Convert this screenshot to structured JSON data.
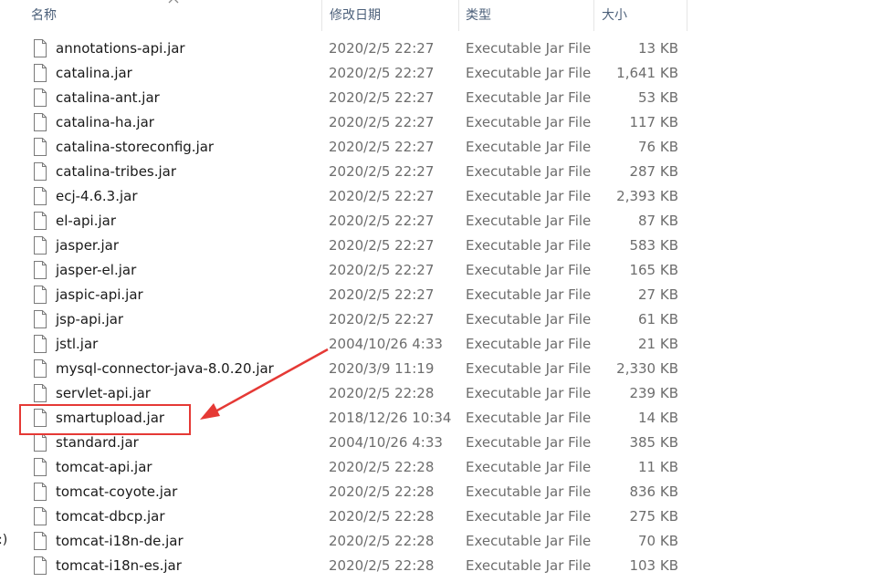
{
  "columns": {
    "name": "名称",
    "date": "修改日期",
    "type": "类型",
    "size": "大小"
  },
  "edge_text": ":)",
  "files": [
    {
      "name": "annotations-api.jar",
      "date": "2020/2/5 22:27",
      "type": "Executable Jar File",
      "size": "13 KB"
    },
    {
      "name": "catalina.jar",
      "date": "2020/2/5 22:27",
      "type": "Executable Jar File",
      "size": "1,641 KB"
    },
    {
      "name": "catalina-ant.jar",
      "date": "2020/2/5 22:27",
      "type": "Executable Jar File",
      "size": "53 KB"
    },
    {
      "name": "catalina-ha.jar",
      "date": "2020/2/5 22:27",
      "type": "Executable Jar File",
      "size": "117 KB"
    },
    {
      "name": "catalina-storeconfig.jar",
      "date": "2020/2/5 22:27",
      "type": "Executable Jar File",
      "size": "76 KB"
    },
    {
      "name": "catalina-tribes.jar",
      "date": "2020/2/5 22:27",
      "type": "Executable Jar File",
      "size": "287 KB"
    },
    {
      "name": "ecj-4.6.3.jar",
      "date": "2020/2/5 22:27",
      "type": "Executable Jar File",
      "size": "2,393 KB"
    },
    {
      "name": "el-api.jar",
      "date": "2020/2/5 22:27",
      "type": "Executable Jar File",
      "size": "87 KB"
    },
    {
      "name": "jasper.jar",
      "date": "2020/2/5 22:27",
      "type": "Executable Jar File",
      "size": "583 KB"
    },
    {
      "name": "jasper-el.jar",
      "date": "2020/2/5 22:27",
      "type": "Executable Jar File",
      "size": "165 KB"
    },
    {
      "name": "jaspic-api.jar",
      "date": "2020/2/5 22:27",
      "type": "Executable Jar File",
      "size": "27 KB"
    },
    {
      "name": "jsp-api.jar",
      "date": "2020/2/5 22:27",
      "type": "Executable Jar File",
      "size": "61 KB"
    },
    {
      "name": "jstl.jar",
      "date": "2004/10/26 4:33",
      "type": "Executable Jar File",
      "size": "21 KB"
    },
    {
      "name": "mysql-connector-java-8.0.20.jar",
      "date": "2020/3/9 11:19",
      "type": "Executable Jar File",
      "size": "2,330 KB"
    },
    {
      "name": "servlet-api.jar",
      "date": "2020/2/5 22:28",
      "type": "Executable Jar File",
      "size": "239 KB"
    },
    {
      "name": "smartupload.jar",
      "date": "2018/12/26 10:34",
      "type": "Executable Jar File",
      "size": "14 KB"
    },
    {
      "name": "standard.jar",
      "date": "2004/10/26 4:33",
      "type": "Executable Jar File",
      "size": "385 KB"
    },
    {
      "name": "tomcat-api.jar",
      "date": "2020/2/5 22:28",
      "type": "Executable Jar File",
      "size": "11 KB"
    },
    {
      "name": "tomcat-coyote.jar",
      "date": "2020/2/5 22:28",
      "type": "Executable Jar File",
      "size": "836 KB"
    },
    {
      "name": "tomcat-dbcp.jar",
      "date": "2020/2/5 22:28",
      "type": "Executable Jar File",
      "size": "275 KB"
    },
    {
      "name": "tomcat-i18n-de.jar",
      "date": "2020/2/5 22:28",
      "type": "Executable Jar File",
      "size": "70 KB"
    },
    {
      "name": "tomcat-i18n-es.jar",
      "date": "2020/2/5 22:28",
      "type": "Executable Jar File",
      "size": "103 KB"
    }
  ],
  "icons": {
    "file": "file-icon",
    "sort": "sort-up-icon",
    "annotation_arrow": "red-arrow-icon"
  },
  "colors": {
    "header_text": "#4c607a",
    "secondary_text": "#6d6d6d",
    "annotation_red": "#e53935"
  }
}
